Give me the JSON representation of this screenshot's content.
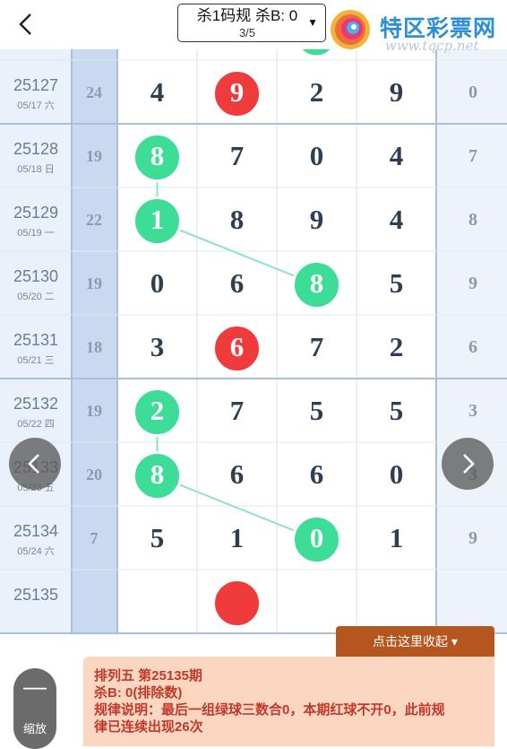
{
  "header": {
    "back_icon": "chevron-left-icon",
    "selector_title": "杀1码规 杀B: 0",
    "selector_sub": "3/5",
    "logo_name": "特区彩票网",
    "logo_url": "www.tqcp.net"
  },
  "colors": {
    "green": "#3ddc97",
    "red": "#ef3b3b",
    "line": "#8ee2c0",
    "accent_brown": "#b5561f",
    "panel": "#fbd7c2"
  },
  "rows": [
    {
      "id": "25127",
      "date": "05/17 六",
      "sum": "24",
      "digits": [
        "4",
        "9",
        "2",
        "9"
      ],
      "hl": [
        null,
        "red",
        null,
        null
      ],
      "last": "0"
    },
    {
      "id": "25128",
      "date": "05/18 日",
      "sum": "19",
      "digits": [
        "8",
        "7",
        "0",
        "4"
      ],
      "hl": [
        "green",
        null,
        null,
        null
      ],
      "last": "7"
    },
    {
      "id": "25129",
      "date": "05/19 一",
      "sum": "22",
      "digits": [
        "1",
        "8",
        "9",
        "4"
      ],
      "hl": [
        "green",
        null,
        null,
        null
      ],
      "last": "8"
    },
    {
      "id": "25130",
      "date": "05/20 二",
      "sum": "19",
      "digits": [
        "0",
        "6",
        "8",
        "5"
      ],
      "hl": [
        null,
        null,
        "green",
        null
      ],
      "last": "9"
    },
    {
      "id": "25131",
      "date": "05/21 三",
      "sum": "18",
      "digits": [
        "3",
        "6",
        "7",
        "2"
      ],
      "hl": [
        null,
        "red",
        null,
        null
      ],
      "last": "6"
    },
    {
      "id": "25132",
      "date": "05/22 四",
      "sum": "19",
      "digits": [
        "2",
        "7",
        "5",
        "5"
      ],
      "hl": [
        "green",
        null,
        null,
        null
      ],
      "last": "3"
    },
    {
      "id": "25133",
      "date": "05/23 五",
      "sum": "20",
      "digits": [
        "8",
        "6",
        "6",
        "0"
      ],
      "hl": [
        "green",
        null,
        null,
        null
      ],
      "last": "3"
    },
    {
      "id": "25134",
      "date": "05/24 六",
      "sum": "7",
      "digits": [
        "5",
        "1",
        "0",
        "1"
      ],
      "hl": [
        null,
        null,
        "green",
        null
      ],
      "last": "9"
    },
    {
      "id": "25135",
      "date": "",
      "sum": "",
      "digits": [
        "",
        "",
        "",
        ""
      ],
      "hl": [
        null,
        "red",
        null,
        null
      ],
      "last": ""
    }
  ],
  "controls": {
    "prev_icon": "chevron-left-icon",
    "next_icon": "chevron-right-icon",
    "zoom_symbol": "—",
    "zoom_label": "缩放",
    "collapse_label": "点击这里收起 ▾"
  },
  "info": {
    "line1": "排列五 第25135期",
    "line2": "杀B: 0(排除数)",
    "line3": "规律说明：最后一组绿球三数合0，本期红球不开0，此前规",
    "line4": "律已连续出现26次"
  }
}
